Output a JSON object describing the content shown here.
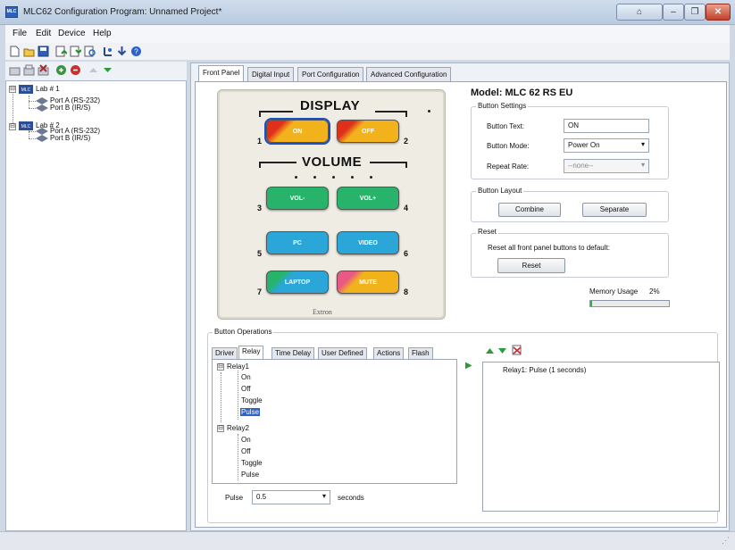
{
  "window": {
    "title": "MLC62 Configuration Program: Unnamed Project*",
    "app_icon_text": "MLC",
    "controls": [
      "maximize-minimize",
      "minimize",
      "restore",
      "close"
    ],
    "control_glyphs": {
      "minimize": "–",
      "restore": "❐",
      "close": "✕",
      "extra": "⌂"
    }
  },
  "menu": {
    "items": [
      "File",
      "Edit",
      "Device",
      "Help"
    ]
  },
  "toolbar": {
    "icons": [
      "new-icon",
      "open-icon",
      "save-icon",
      "upload-icon",
      "download-icon",
      "refresh-icon",
      "connect-icon",
      "arrow-down-icon",
      "help-icon"
    ]
  },
  "left_toolbar": {
    "icons": [
      "add-device-icon",
      "copy-device-icon",
      "delete-device-icon",
      "green-circle-icon",
      "red-circle-icon",
      "move-up-icon",
      "move-down-icon"
    ]
  },
  "tree": {
    "labs": [
      {
        "label": "Lab # 1",
        "expander": "⊟",
        "ports": [
          "Port A (RS-232)",
          "Port B (IR/S)"
        ]
      },
      {
        "label": "Lab # 2",
        "expander": "⊟",
        "ports": [
          "Port A (RS-232)",
          "Port B (IR/S)"
        ]
      }
    ]
  },
  "tabs": {
    "items": [
      "Front Panel",
      "Digital Input",
      "Port Configuration",
      "Advanced Configuration"
    ],
    "active": "Front Panel"
  },
  "front_panel": {
    "display_label": "DISPLAY",
    "volume_label": "VOLUME",
    "brand": "Extron",
    "buttons": [
      {
        "num": "1",
        "label": "ON",
        "color": "#f2b21c",
        "accent": "#e0301c",
        "selected": true
      },
      {
        "num": "2",
        "label": "OFF",
        "color": "#f2b21c",
        "accent": "#e0301c",
        "selected": false
      },
      {
        "num": "3",
        "label": "VOL-",
        "color": "#27b46a",
        "accent": "#27b46a",
        "selected": false
      },
      {
        "num": "4",
        "label": "VOL+",
        "color": "#27b46a",
        "accent": "#27b46a",
        "selected": false
      },
      {
        "num": "5",
        "label": "PC",
        "color": "#2aa6d8",
        "accent": "#2aa6d8",
        "selected": false
      },
      {
        "num": "6",
        "label": "VIDEO",
        "color": "#2aa6d8",
        "accent": "#2aa6d8",
        "selected": false
      },
      {
        "num": "7",
        "label": "LAPTOP",
        "color": "#2aa6d8",
        "accent": "#27b46a",
        "selected": false
      },
      {
        "num": "8",
        "label": "MUTE",
        "color": "#f2b21c",
        "accent": "#e85a84",
        "selected": false
      }
    ]
  },
  "model": {
    "title": "Model: MLC 62 RS EU"
  },
  "button_settings": {
    "group": "Button Settings",
    "text_label": "Button Text:",
    "text_value": "ON",
    "mode_label": "Button Mode:",
    "mode_value": "Power On",
    "repeat_label": "Repeat Rate:",
    "repeat_value": "--none--",
    "dropdown_arrow": "▾"
  },
  "button_layout": {
    "group": "Button Layout",
    "combine": "Combine",
    "separate": "Separate"
  },
  "reset": {
    "group": "Reset",
    "text": "Reset all front panel buttons to default:",
    "button": "Reset"
  },
  "memory": {
    "label": "Memory Usage",
    "value": "2%",
    "fraction": 0.02
  },
  "button_operations": {
    "group": "Button Operations",
    "tabs": [
      "Driver",
      "Relay",
      "Time Delay",
      "User Defined",
      "Actions",
      "Flash"
    ],
    "active_tab": "Relay",
    "tree": [
      {
        "label": "Relay1",
        "expander": "⊟",
        "children": [
          "On",
          "Off",
          "Toggle",
          "Pulse"
        ],
        "selected_child": "Pulse"
      },
      {
        "label": "Relay2",
        "expander": "⊟",
        "children": [
          "On",
          "Off",
          "Toggle",
          "Pulse"
        ],
        "selected_child": ""
      }
    ],
    "pulse_label": "Pulse",
    "pulse_value": "0.5",
    "seconds_label": "seconds",
    "list_items": [
      "Relay1: Pulse (1 seconds)"
    ],
    "arrow_glyph": "▶"
  },
  "status_bar": {
    "grip": "⋰"
  }
}
